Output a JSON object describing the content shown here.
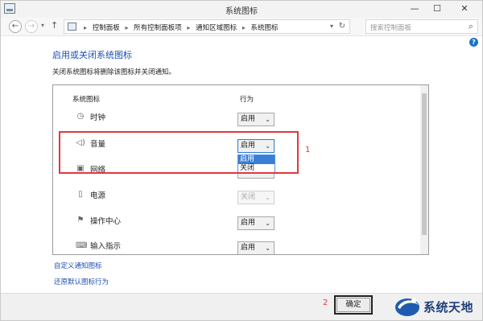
{
  "window": {
    "title": "系统图标",
    "min_glyph": "—",
    "max_glyph": "☐",
    "close_glyph": "✕"
  },
  "nav": {
    "back_glyph": "←",
    "forward_glyph": "→",
    "up_glyph": "↑",
    "dropdown_glyph": "▾",
    "refresh_glyph": "↻",
    "breadcrumbs": [
      "控制面板",
      "所有控制面板项",
      "通知区域图标",
      "系统图标"
    ],
    "separator": "▸",
    "search_placeholder": "搜索控制面板"
  },
  "help_glyph": "?",
  "page": {
    "heading": "启用或关闭系统图标",
    "description": "关闭系统图标将删除该图标并关闭通知。"
  },
  "table": {
    "col_icon": "系统图标",
    "col_behavior": "行为",
    "rows": [
      {
        "icon": "clock-icon",
        "icon_glyph": "◷",
        "label": "时钟",
        "value": "启用",
        "disabled": false
      },
      {
        "icon": "speaker-icon",
        "icon_glyph": "🔈",
        "label": "音量",
        "value": "启用",
        "disabled": false,
        "open": true
      },
      {
        "icon": "network-icon",
        "icon_glyph": "▣",
        "label": "网络",
        "value": "启用",
        "disabled": false
      },
      {
        "icon": "power-icon",
        "icon_glyph": "▯",
        "label": "电源",
        "value": "关闭",
        "disabled": true
      },
      {
        "icon": "flag-icon",
        "icon_glyph": "⚑",
        "label": "操作中心",
        "value": "启用",
        "disabled": false
      },
      {
        "icon": "keyboard-icon",
        "icon_glyph": "⌨",
        "label": "输入指示",
        "value": "启用",
        "disabled": false
      }
    ],
    "dropdown_options": [
      "启用",
      "关闭"
    ],
    "dropdown_highlighted": "启用"
  },
  "annotations": {
    "one": "1",
    "two": "2"
  },
  "links": {
    "customize": "自定义通知图标",
    "restore": "还原默认图标行为"
  },
  "ok_label": "确定",
  "watermark": {
    "text": "系统天地"
  },
  "colors": {
    "accent": "#1e4fb3",
    "annotation": "#e0383e",
    "highlight": "#3a7fd6"
  }
}
